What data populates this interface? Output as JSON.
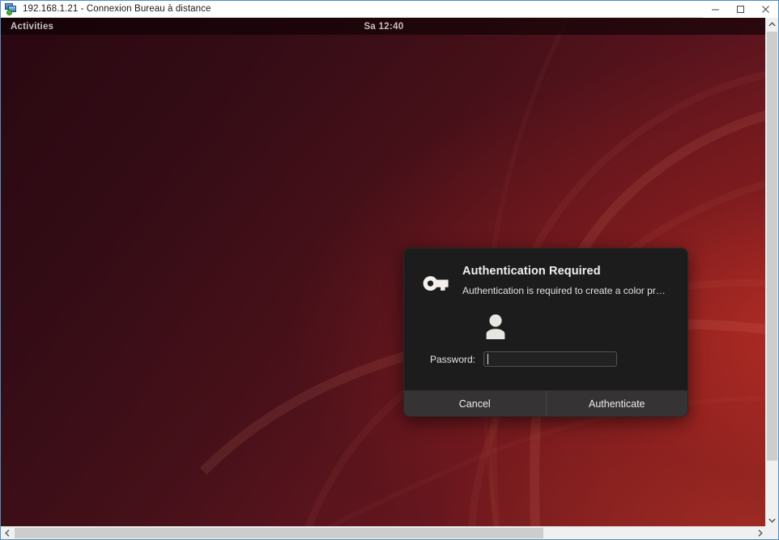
{
  "window": {
    "title": "192.168.1.21 - Connexion Bureau à distance",
    "icon": "remote-desktop-icon",
    "controls": {
      "minimize": "minimize-icon",
      "maximize": "maximize-icon",
      "close": "close-icon"
    }
  },
  "desktop": {
    "topbar": {
      "activities_label": "Activities",
      "clock": "Sa 12:40"
    },
    "wallpaper_colors": {
      "dark": "#2a0811",
      "mid": "#631620",
      "bright": "#8e2224"
    }
  },
  "dialog": {
    "key_icon": "key-icon",
    "title": "Authentication Required",
    "subtitle": "Authentication is required to create a color pr…",
    "avatar_icon": "user-avatar-icon",
    "password_label": "Password:",
    "password_value": "",
    "password_placeholder": "",
    "cancel_label": "Cancel",
    "authenticate_label": "Authenticate",
    "colors": {
      "body": "#1d1c1c",
      "buttons": "#353333",
      "text": "#f2f0ee"
    }
  },
  "scrollbars": {
    "vertical": {
      "up_arrow": "chevron-up-icon",
      "down_arrow": "chevron-down-icon"
    },
    "horizontal": {
      "left_arrow": "chevron-left-icon",
      "right_arrow": "chevron-right-icon"
    }
  }
}
